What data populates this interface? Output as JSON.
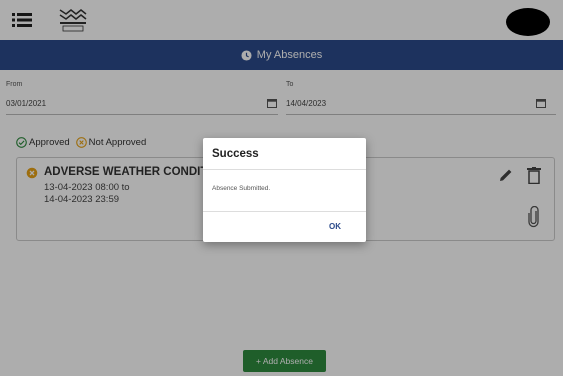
{
  "page": {
    "title": "My Absences"
  },
  "range": {
    "from_label": "From",
    "from_value": "03/01/2021",
    "to_label": "To",
    "to_value": "14/04/2023"
  },
  "legend": {
    "approved_label": "Approved",
    "not_approved_label": "Not Approved",
    "approved_color": "#2e8b3e",
    "not_approved_color": "#e8a317"
  },
  "absence": {
    "title": "ADVERSE WEATHER CONDITION",
    "start": "13-04-2023 08:00 to",
    "end": "14-04-2023 23:59",
    "status": "not-approved"
  },
  "actions": {
    "add_label": "+ Add Absence"
  },
  "dialog": {
    "title": "Success",
    "message": "Absence Submitted.",
    "ok_label": "OK"
  },
  "icons": {
    "menu": "menu-icon",
    "logo": "logo-icon",
    "avatar": "avatar",
    "clock": "clock-icon",
    "calendar": "calendar-icon",
    "edit": "pencil-icon",
    "delete": "trash-icon",
    "attachment": "paperclip-icon"
  },
  "colors": {
    "header": "#2b4a8b",
    "accent": "#2e8b3e"
  }
}
